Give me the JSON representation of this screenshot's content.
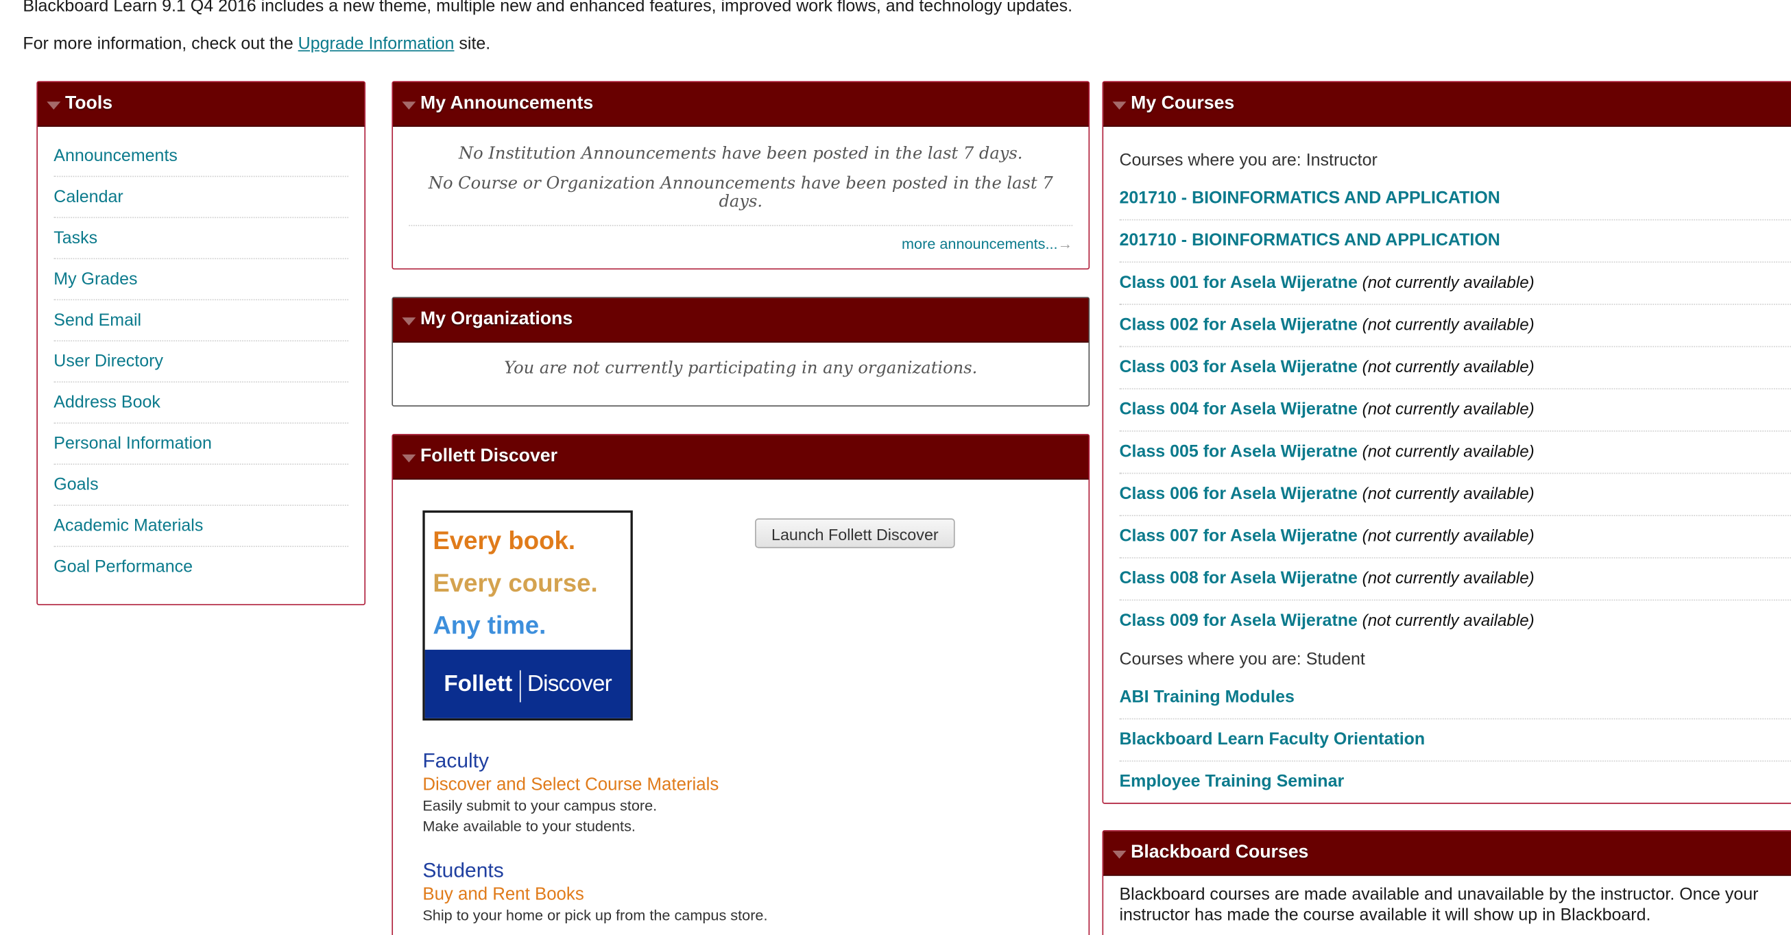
{
  "intro": {
    "line1": "Blackboard Learn 9.1 Q4 2016 includes a new theme, multiple new and enhanced features, improved work flows, and technology updates.",
    "line2_before": "For more information, check out the ",
    "line2_link": "Upgrade Information",
    "line2_after": " site."
  },
  "tools": {
    "title": "Tools",
    "items": [
      "Announcements",
      "Calendar",
      "Tasks",
      "My Grades",
      "Send Email",
      "User Directory",
      "Address Book",
      "Personal Information",
      "Goals",
      "Academic Materials",
      "Goal Performance"
    ]
  },
  "announcements": {
    "title": "My Announcements",
    "line1": "No Institution Announcements have been posted in the last 7 days.",
    "line2": "No Course or Organization Announcements have been posted in the last 7 days.",
    "more": "more announcements...",
    "arrow": "→"
  },
  "organizations": {
    "title": "My Organizations",
    "message": "You are not currently participating in any organizations."
  },
  "follett": {
    "title": "Follett Discover",
    "logo": {
      "line1": "Every book.",
      "line2": "Every course.",
      "line3": "Any time.",
      "brand": "Follett",
      "product": "Discover"
    },
    "button": "Launch Follett Discover",
    "faculty": {
      "heading": "Faculty",
      "sub": "Discover and Select Course Materials",
      "t1": "Easily submit to your campus store.",
      "t2": "Make available to your students."
    },
    "students": {
      "heading": "Students",
      "sub": "Buy and Rent Books",
      "t1": "Ship to your home or pick up from the campus store."
    }
  },
  "courses": {
    "title": "My Courses",
    "instructor_label": "Courses where you are: Instructor",
    "instructor": [
      {
        "name": "201710 - BIOINFORMATICS AND APPLICATION",
        "note": ""
      },
      {
        "name": "201710 - BIOINFORMATICS AND APPLICATION",
        "note": ""
      },
      {
        "name": "Class 001 for Asela Wijeratne",
        "note": " (not currently available)"
      },
      {
        "name": "Class 002 for Asela Wijeratne",
        "note": " (not currently available)"
      },
      {
        "name": "Class 003 for Asela Wijeratne",
        "note": " (not currently available)"
      },
      {
        "name": "Class 004 for Asela Wijeratne",
        "note": " (not currently available)"
      },
      {
        "name": "Class 005 for Asela Wijeratne",
        "note": " (not currently available)"
      },
      {
        "name": "Class 006 for Asela Wijeratne",
        "note": " (not currently available)"
      },
      {
        "name": "Class 007 for Asela Wijeratne",
        "note": " (not currently available)"
      },
      {
        "name": "Class 008 for Asela Wijeratne",
        "note": " (not currently available)"
      },
      {
        "name": "Class 009 for Asela Wijeratne",
        "note": " (not currently available)"
      }
    ],
    "student_label": "Courses where you are: Student",
    "student": [
      {
        "name": "ABI Training Modules"
      },
      {
        "name": "Blackboard Learn Faculty Orientation"
      },
      {
        "name": "Employee Training Seminar"
      }
    ]
  },
  "bb_courses": {
    "title": "Blackboard Courses",
    "text": "Blackboard courses are made available and unavailable by the instructor. Once your instructor has made the course available it will show up in Blackboard."
  },
  "colors": {
    "header_bg": "#680000",
    "link": "#0b7a8c",
    "border": "#b0203c",
    "follett_orange": "#e07b1a",
    "follett_blue": "#0a2e8f"
  }
}
